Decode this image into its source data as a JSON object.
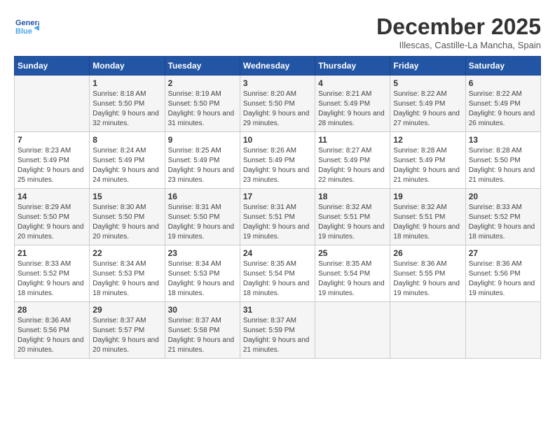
{
  "logo": {
    "line1": "General",
    "line2": "Blue",
    "arrow": "▶"
  },
  "header": {
    "title": "December 2025",
    "location": "Illescas, Castille-La Mancha, Spain"
  },
  "weekdays": [
    "Sunday",
    "Monday",
    "Tuesday",
    "Wednesday",
    "Thursday",
    "Friday",
    "Saturday"
  ],
  "weeks": [
    [
      {
        "day": "",
        "sunrise": "",
        "sunset": "",
        "daylight": ""
      },
      {
        "day": "1",
        "sunrise": "Sunrise: 8:18 AM",
        "sunset": "Sunset: 5:50 PM",
        "daylight": "Daylight: 9 hours and 32 minutes."
      },
      {
        "day": "2",
        "sunrise": "Sunrise: 8:19 AM",
        "sunset": "Sunset: 5:50 PM",
        "daylight": "Daylight: 9 hours and 31 minutes."
      },
      {
        "day": "3",
        "sunrise": "Sunrise: 8:20 AM",
        "sunset": "Sunset: 5:50 PM",
        "daylight": "Daylight: 9 hours and 29 minutes."
      },
      {
        "day": "4",
        "sunrise": "Sunrise: 8:21 AM",
        "sunset": "Sunset: 5:49 PM",
        "daylight": "Daylight: 9 hours and 28 minutes."
      },
      {
        "day": "5",
        "sunrise": "Sunrise: 8:22 AM",
        "sunset": "Sunset: 5:49 PM",
        "daylight": "Daylight: 9 hours and 27 minutes."
      },
      {
        "day": "6",
        "sunrise": "Sunrise: 8:22 AM",
        "sunset": "Sunset: 5:49 PM",
        "daylight": "Daylight: 9 hours and 26 minutes."
      }
    ],
    [
      {
        "day": "7",
        "sunrise": "Sunrise: 8:23 AM",
        "sunset": "Sunset: 5:49 PM",
        "daylight": "Daylight: 9 hours and 25 minutes."
      },
      {
        "day": "8",
        "sunrise": "Sunrise: 8:24 AM",
        "sunset": "Sunset: 5:49 PM",
        "daylight": "Daylight: 9 hours and 24 minutes."
      },
      {
        "day": "9",
        "sunrise": "Sunrise: 8:25 AM",
        "sunset": "Sunset: 5:49 PM",
        "daylight": "Daylight: 9 hours and 23 minutes."
      },
      {
        "day": "10",
        "sunrise": "Sunrise: 8:26 AM",
        "sunset": "Sunset: 5:49 PM",
        "daylight": "Daylight: 9 hours and 23 minutes."
      },
      {
        "day": "11",
        "sunrise": "Sunrise: 8:27 AM",
        "sunset": "Sunset: 5:49 PM",
        "daylight": "Daylight: 9 hours and 22 minutes."
      },
      {
        "day": "12",
        "sunrise": "Sunrise: 8:28 AM",
        "sunset": "Sunset: 5:49 PM",
        "daylight": "Daylight: 9 hours and 21 minutes."
      },
      {
        "day": "13",
        "sunrise": "Sunrise: 8:28 AM",
        "sunset": "Sunset: 5:50 PM",
        "daylight": "Daylight: 9 hours and 21 minutes."
      }
    ],
    [
      {
        "day": "14",
        "sunrise": "Sunrise: 8:29 AM",
        "sunset": "Sunset: 5:50 PM",
        "daylight": "Daylight: 9 hours and 20 minutes."
      },
      {
        "day": "15",
        "sunrise": "Sunrise: 8:30 AM",
        "sunset": "Sunset: 5:50 PM",
        "daylight": "Daylight: 9 hours and 20 minutes."
      },
      {
        "day": "16",
        "sunrise": "Sunrise: 8:31 AM",
        "sunset": "Sunset: 5:50 PM",
        "daylight": "Daylight: 9 hours and 19 minutes."
      },
      {
        "day": "17",
        "sunrise": "Sunrise: 8:31 AM",
        "sunset": "Sunset: 5:51 PM",
        "daylight": "Daylight: 9 hours and 19 minutes."
      },
      {
        "day": "18",
        "sunrise": "Sunrise: 8:32 AM",
        "sunset": "Sunset: 5:51 PM",
        "daylight": "Daylight: 9 hours and 19 minutes."
      },
      {
        "day": "19",
        "sunrise": "Sunrise: 8:32 AM",
        "sunset": "Sunset: 5:51 PM",
        "daylight": "Daylight: 9 hours and 18 minutes."
      },
      {
        "day": "20",
        "sunrise": "Sunrise: 8:33 AM",
        "sunset": "Sunset: 5:52 PM",
        "daylight": "Daylight: 9 hours and 18 minutes."
      }
    ],
    [
      {
        "day": "21",
        "sunrise": "Sunrise: 8:33 AM",
        "sunset": "Sunset: 5:52 PM",
        "daylight": "Daylight: 9 hours and 18 minutes."
      },
      {
        "day": "22",
        "sunrise": "Sunrise: 8:34 AM",
        "sunset": "Sunset: 5:53 PM",
        "daylight": "Daylight: 9 hours and 18 minutes."
      },
      {
        "day": "23",
        "sunrise": "Sunrise: 8:34 AM",
        "sunset": "Sunset: 5:53 PM",
        "daylight": "Daylight: 9 hours and 18 minutes."
      },
      {
        "day": "24",
        "sunrise": "Sunrise: 8:35 AM",
        "sunset": "Sunset: 5:54 PM",
        "daylight": "Daylight: 9 hours and 18 minutes."
      },
      {
        "day": "25",
        "sunrise": "Sunrise: 8:35 AM",
        "sunset": "Sunset: 5:54 PM",
        "daylight": "Daylight: 9 hours and 19 minutes."
      },
      {
        "day": "26",
        "sunrise": "Sunrise: 8:36 AM",
        "sunset": "Sunset: 5:55 PM",
        "daylight": "Daylight: 9 hours and 19 minutes."
      },
      {
        "day": "27",
        "sunrise": "Sunrise: 8:36 AM",
        "sunset": "Sunset: 5:56 PM",
        "daylight": "Daylight: 9 hours and 19 minutes."
      }
    ],
    [
      {
        "day": "28",
        "sunrise": "Sunrise: 8:36 AM",
        "sunset": "Sunset: 5:56 PM",
        "daylight": "Daylight: 9 hours and 20 minutes."
      },
      {
        "day": "29",
        "sunrise": "Sunrise: 8:37 AM",
        "sunset": "Sunset: 5:57 PM",
        "daylight": "Daylight: 9 hours and 20 minutes."
      },
      {
        "day": "30",
        "sunrise": "Sunrise: 8:37 AM",
        "sunset": "Sunset: 5:58 PM",
        "daylight": "Daylight: 9 hours and 21 minutes."
      },
      {
        "day": "31",
        "sunrise": "Sunrise: 8:37 AM",
        "sunset": "Sunset: 5:59 PM",
        "daylight": "Daylight: 9 hours and 21 minutes."
      },
      {
        "day": "",
        "sunrise": "",
        "sunset": "",
        "daylight": ""
      },
      {
        "day": "",
        "sunrise": "",
        "sunset": "",
        "daylight": ""
      },
      {
        "day": "",
        "sunrise": "",
        "sunset": "",
        "daylight": ""
      }
    ]
  ]
}
